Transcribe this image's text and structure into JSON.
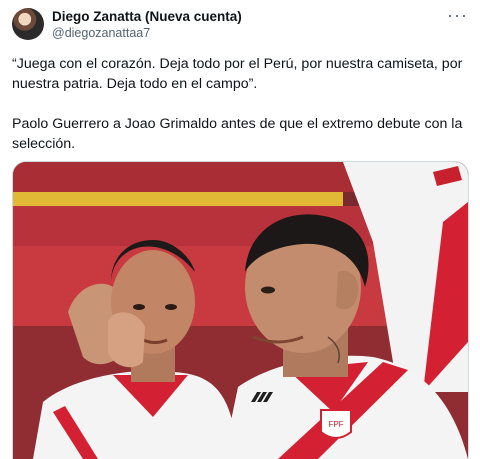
{
  "author": {
    "display_name": "Diego Zanatta (Nueva cuenta)",
    "handle": "@diegozanattaa7"
  },
  "more_icon": "more-horizontal-icon",
  "tweet": {
    "paragraph_1": "“Juega con el corazón. Deja todo por el Perú, por nuestra camiseta, por nuestra patria. Deja todo en el campo”.",
    "paragraph_2": "Paolo Guerrero a Joao Grimaldo antes de que el extremo debute con la selección."
  },
  "media": {
    "kind": "photo",
    "colors": {
      "jersey": "#ffffff",
      "stripe": "#d32032",
      "background_red": "#b7323a",
      "background_yellow": "#e2b936"
    }
  }
}
